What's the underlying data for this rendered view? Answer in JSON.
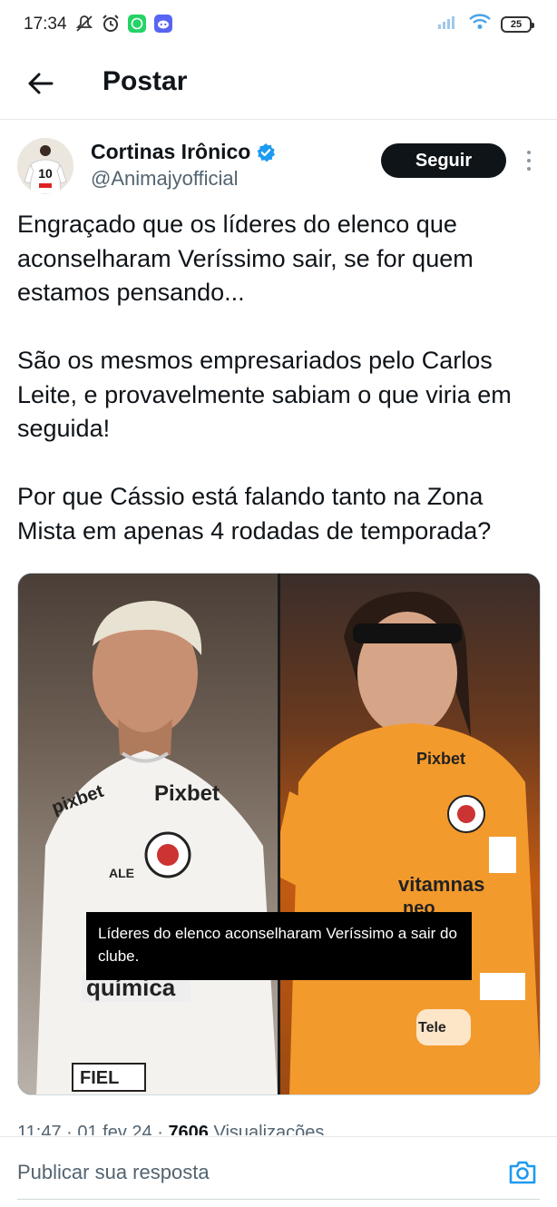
{
  "status_bar": {
    "time": "17:34",
    "battery": "25",
    "icons": [
      "mute-icon",
      "alarm-icon",
      "whatsapp-icon",
      "discord-icon",
      "signal-icon",
      "wifi-icon",
      "battery-icon"
    ]
  },
  "header": {
    "title": "Postar"
  },
  "author": {
    "name": "Cortinas Irônico",
    "handle": "@Animajyofficial",
    "verified": true,
    "follow_label": "Seguir"
  },
  "tweet": {
    "paragraphs": [
      "Engraçado que os líderes do elenco que aconselharam Veríssimo sair, se for quem estamos pensando...",
      "São os mesmos empresariados pelo Carlos Leite, e provavelmente sabiam o que viria em seguida!",
      "Por que Cássio está falando tanto na Zona Mista em apenas 4 rodadas de temporada?"
    ],
    "image_caption": "Líderes do elenco aconselharam Veríssimo a sair do clube."
  },
  "meta": {
    "time": "11:47",
    "date": "01 fev 24",
    "views_count": "7606",
    "views_label": "Visualizações"
  },
  "reply": {
    "placeholder": "Publicar sua resposta"
  },
  "colors": {
    "accent": "#1d9bf0",
    "text": "#0f1419",
    "muted": "#536471"
  }
}
